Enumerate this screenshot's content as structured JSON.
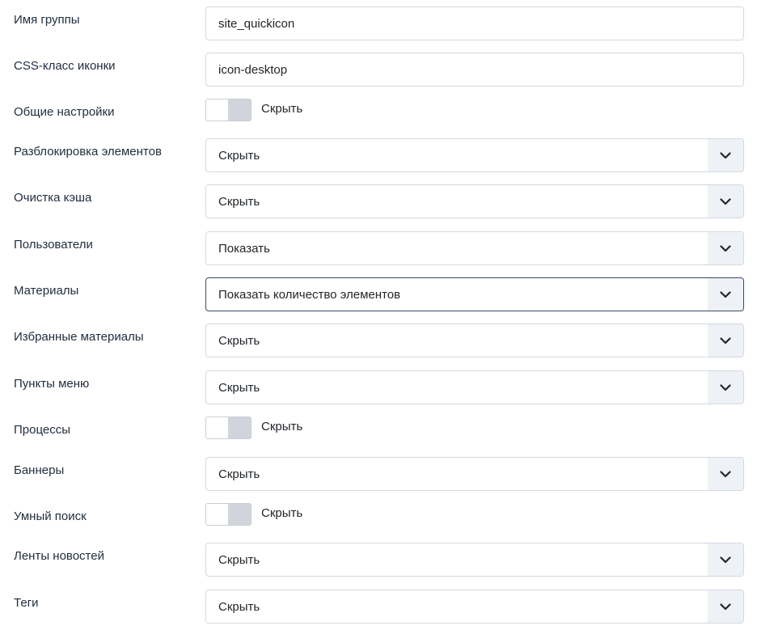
{
  "fields": [
    {
      "label": "Имя группы",
      "type": "text",
      "value": "site_quickicon"
    },
    {
      "label": "CSS-класс иконки",
      "type": "text",
      "value": "icon-desktop"
    },
    {
      "label": "Общие настройки",
      "type": "toggle",
      "value": "Скрыть"
    },
    {
      "label": "Разблокировка элементов",
      "type": "select",
      "value": "Скрыть"
    },
    {
      "label": "Очистка кэша",
      "type": "select",
      "value": "Скрыть"
    },
    {
      "label": "Пользователи",
      "type": "select",
      "value": "Показать"
    },
    {
      "label": "Материалы",
      "type": "select",
      "value": "Показать количество элементов",
      "focused": true
    },
    {
      "label": "Избранные материалы",
      "type": "select",
      "value": "Скрыть"
    },
    {
      "label": "Пункты меню",
      "type": "select",
      "value": "Скрыть"
    },
    {
      "label": "Процессы",
      "type": "toggle",
      "value": "Скрыть"
    },
    {
      "label": "Баннеры",
      "type": "select",
      "value": "Скрыть"
    },
    {
      "label": "Умный поиск",
      "type": "toggle",
      "value": "Скрыть"
    },
    {
      "label": "Ленты новостей",
      "type": "select",
      "value": "Скрыть"
    },
    {
      "label": "Теги",
      "type": "select",
      "value": "Скрыть"
    }
  ],
  "icons": {
    "select_caret": "chevron-down-icon"
  },
  "colors": {
    "border": "#d3d9e0",
    "focus_border": "#3b4a63",
    "caret_bg": "#eef1f5",
    "toggle_off": "#d1d5db"
  }
}
